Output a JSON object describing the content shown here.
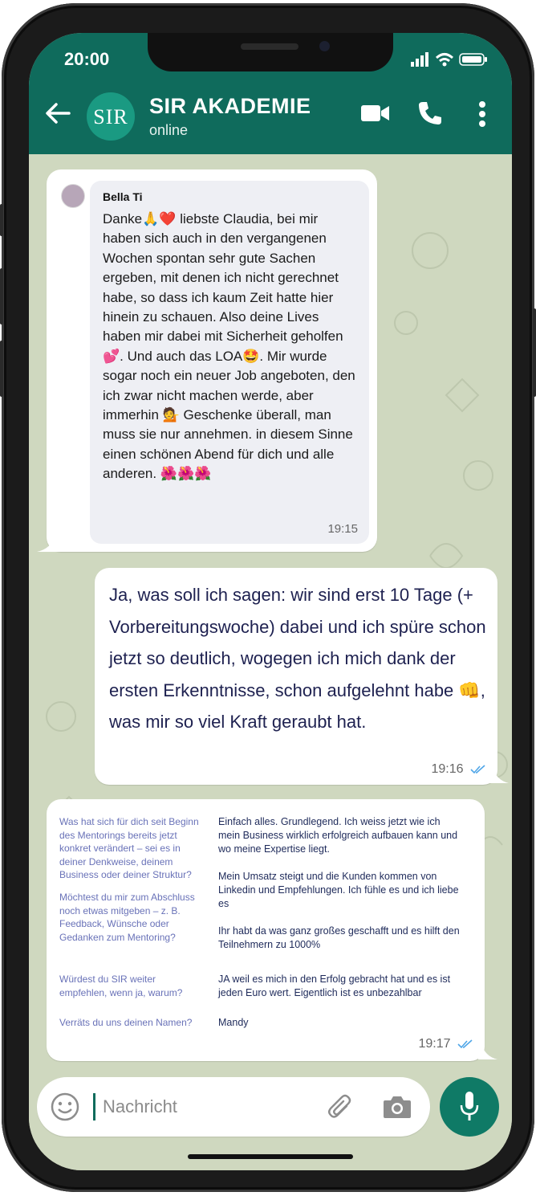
{
  "status_bar": {
    "time": "20:00"
  },
  "header": {
    "avatar_text": "SIR",
    "title": "SIR AKADEMIE",
    "subtitle": "online"
  },
  "messages": [
    {
      "sender": "Bella Ti",
      "text": "Danke🙏❤️ liebste Claudia, bei mir haben sich auch in den vergangenen Wochen spontan sehr gute Sachen ergeben, mit denen ich nicht gerechnet habe, so dass ich kaum Zeit hatte hier hinein zu schauen. Also deine Lives haben mir dabei mit Sicherheit geholfen💕. Und auch das LOA🤩. Mir wurde sogar noch ein neuer Job angeboten, den ich zwar nicht machen werde, aber immerhin 💁 Geschenke überall, man muss sie nur annehmen. in diesem Sinne einen schönen Abend für dich und alle anderen. 🌺🌺🌺",
      "time": "19:15"
    },
    {
      "text": "Ja, was soll ich sagen: wir sind erst 10 Tage (+ Vorbereitungswoche) dabei und ich spüre schon jetzt so deutlich, wogegen ich mich dank der ersten Erkenntnisse, schon aufgelehnt habe 👊, was mir so viel Kraft geraubt hat.",
      "time": "19:16"
    },
    {
      "qa": [
        {
          "q": "Was hat sich für dich seit Beginn des Mentorings bereits jetzt konkret verändert – sei es in deiner Denkweise, deinem Business oder deiner Struktur?",
          "a": "Einfach alles. Grundlegend. Ich weiss jetzt wie ich mein Business wirklich erfolgreich aufbauen kann und wo meine Expertise liegt.\n\nMein Umsatz steigt und die Kunden kommen von Linkedin und Empfehlungen. Ich fühle es und ich liebe es"
        },
        {
          "q": "Möchtest du mir zum Abschluss noch etwas mitgeben – z. B. Feedback, Wünsche oder Gedanken zum Mentoring?",
          "a": "Ihr habt da was ganz großes geschafft und es hilft den Teilnehmern  zu 1000%"
        },
        {
          "q": "Würdest du SIR weiter empfehlen, wenn ja, warum?",
          "a": "JA weil es mich in den Erfolg gebracht hat und es ist jeden Euro wert. Eigentlich ist es unbezahlbar"
        },
        {
          "q": "Verräts du uns deinen Namen?",
          "a": "Mandy"
        }
      ],
      "time": "19:17"
    }
  ],
  "input": {
    "placeholder": "Nachricht"
  },
  "colors": {
    "header": "#0f6b5c",
    "accent": "#0f7a66",
    "chat_bg": "#cfd8bf",
    "tick_blue": "#4fa6e8"
  },
  "icons": [
    "back-arrow-icon",
    "video-call-icon",
    "phone-icon",
    "more-vert-icon",
    "emoji-icon",
    "attach-icon",
    "camera-icon",
    "mic-icon",
    "double-tick-icon",
    "signal-icon",
    "wifi-icon",
    "battery-icon"
  ]
}
